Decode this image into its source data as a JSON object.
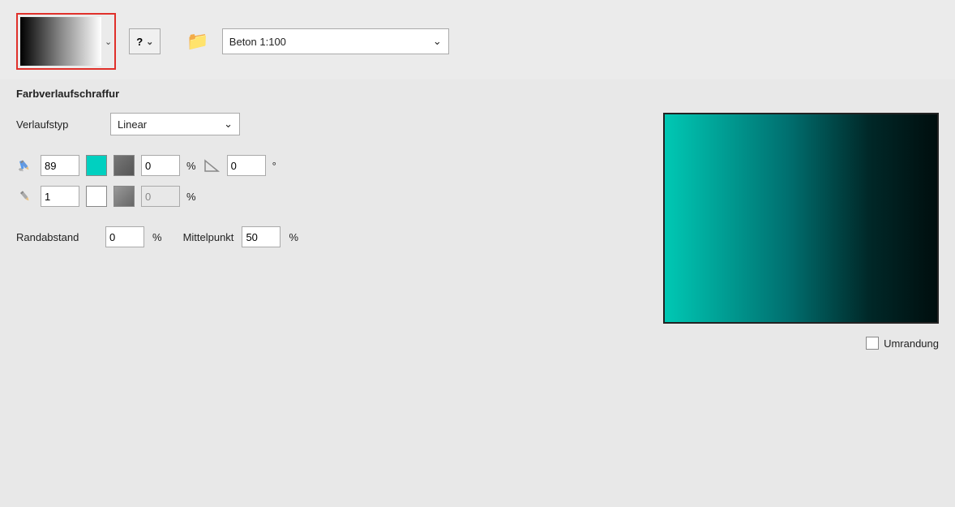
{
  "topbar": {
    "preset_label": "Beton 1:100",
    "question_mark": "?",
    "chevron": "⌄"
  },
  "section": {
    "title": "Farbverlaufschraffur"
  },
  "verlaufstyp": {
    "label": "Verlaufstyp",
    "value": "Linear",
    "chevron": "⌄"
  },
  "stops": [
    {
      "position": "89",
      "color_label": "cyan",
      "opacity": "0",
      "opacity_unit": "%",
      "angle": "0",
      "angle_unit": "°"
    },
    {
      "position": "1",
      "color_label": "white",
      "opacity": "0",
      "opacity_unit": "%"
    }
  ],
  "rand": {
    "label": "Randabstand",
    "value": "0",
    "unit": "%"
  },
  "mittelpunkt": {
    "label": "Mittelpunkt",
    "value": "50",
    "unit": "%"
  },
  "umrandung": {
    "label": "Umrandung"
  },
  "icons": {
    "folder": "📁",
    "chevron_down": "⌄"
  }
}
